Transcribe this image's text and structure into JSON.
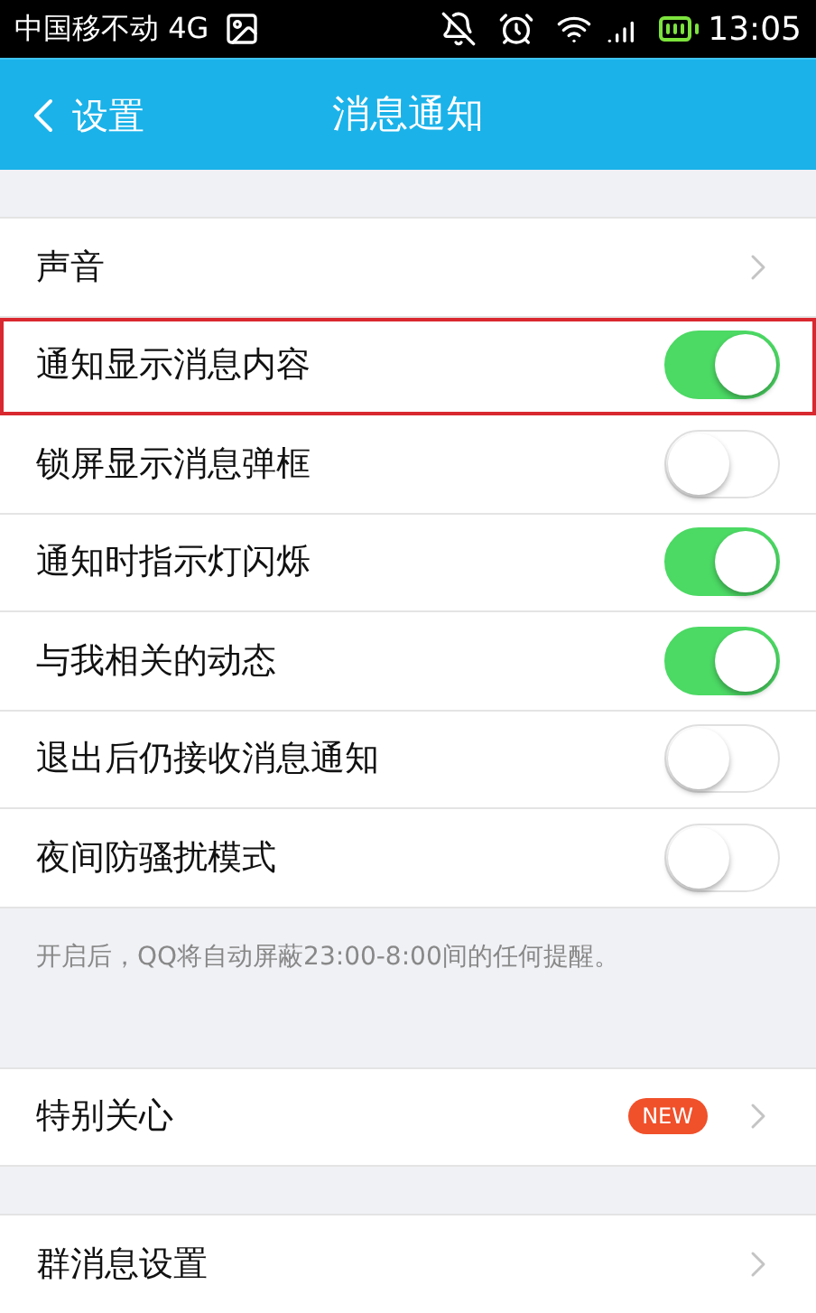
{
  "status_bar": {
    "carrier": "中国移不动 4G",
    "time": "13:05"
  },
  "header": {
    "back": "设置",
    "title": "消息通知"
  },
  "sections": [
    {
      "rows": [
        {
          "kind": "link",
          "label": "声音",
          "highlighted": false
        },
        {
          "kind": "toggle",
          "label": "通知显示消息内容",
          "on": true,
          "highlighted": true
        },
        {
          "kind": "toggle",
          "label": "锁屏显示消息弹框",
          "on": false,
          "highlighted": false
        },
        {
          "kind": "toggle",
          "label": "通知时指示灯闪烁",
          "on": true,
          "highlighted": false
        },
        {
          "kind": "toggle",
          "label": "与我相关的动态",
          "on": true,
          "highlighted": false
        },
        {
          "kind": "toggle",
          "label": "退出后仍接收消息通知",
          "on": false,
          "highlighted": false
        },
        {
          "kind": "toggle",
          "label": "夜间防骚扰模式",
          "on": false,
          "highlighted": false
        }
      ],
      "note": "开启后，QQ将自动屏蔽23:00-8:00间的任何提醒。"
    },
    {
      "rows": [
        {
          "kind": "link",
          "label": "特别关心",
          "badge": "NEW",
          "highlighted": false
        }
      ]
    },
    {
      "rows": [
        {
          "kind": "link",
          "label": "群消息设置",
          "highlighted": false
        }
      ]
    }
  ]
}
